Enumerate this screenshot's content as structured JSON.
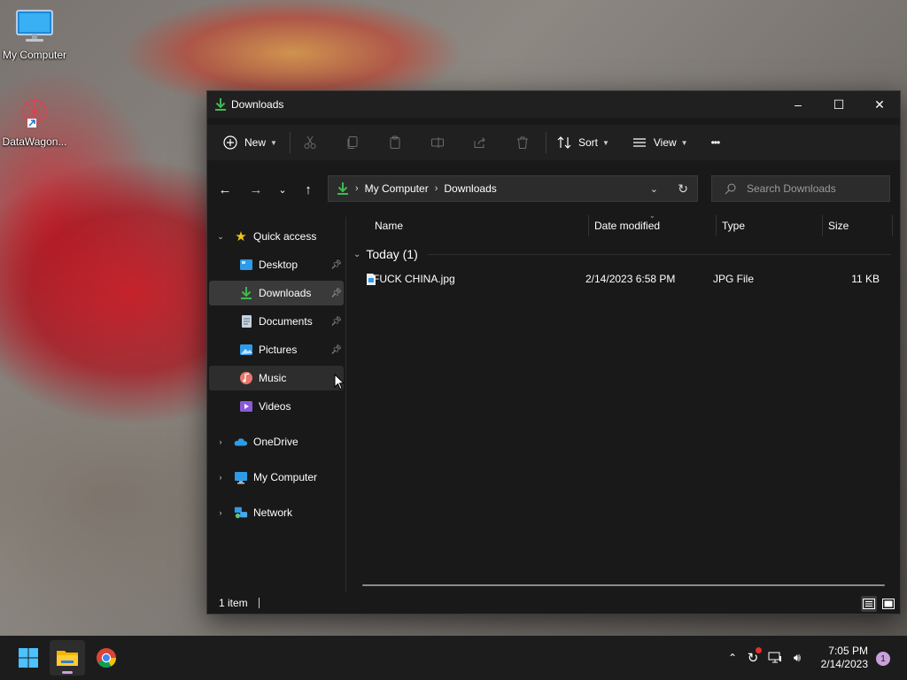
{
  "desktop": {
    "icons": [
      {
        "label": "My Computer",
        "icon": "monitor-icon"
      },
      {
        "label": "DataWagon...",
        "icon": "shortcut-icon"
      }
    ]
  },
  "window": {
    "title": "Downloads",
    "controls": {
      "minimize": "–",
      "maximize": "☐",
      "close": "✕"
    }
  },
  "toolbar": {
    "new_label": "New",
    "sort_label": "Sort",
    "view_label": "View",
    "more_label": "•••"
  },
  "address": {
    "crumbs": [
      "My Computer",
      "Downloads"
    ],
    "search_placeholder": "Search Downloads"
  },
  "sidebar": {
    "quick_access": "Quick access",
    "items": [
      {
        "label": "Desktop",
        "pinned": true
      },
      {
        "label": "Downloads",
        "pinned": true,
        "selected": true
      },
      {
        "label": "Documents",
        "pinned": true
      },
      {
        "label": "Pictures",
        "pinned": true
      },
      {
        "label": "Music",
        "pinned": false
      },
      {
        "label": "Videos",
        "pinned": false
      }
    ],
    "roots": [
      "OneDrive",
      "My Computer",
      "Network"
    ]
  },
  "columns": {
    "name": "Name",
    "date": "Date modified",
    "type": "Type",
    "size": "Size"
  },
  "group": {
    "label": "Today (1)"
  },
  "files": [
    {
      "name": "FUCK CHINA.jpg",
      "date": "2/14/2023 6:58 PM",
      "type": "JPG File",
      "size": "11 KB"
    }
  ],
  "status": {
    "count": "1 item"
  },
  "taskbar": {
    "time": "7:05 PM",
    "date": "2/14/2023",
    "notifications": "1"
  },
  "colors": {
    "accent": "#4cc2ff",
    "download_green": "#3fb950",
    "selection": "#3a3a3a"
  }
}
